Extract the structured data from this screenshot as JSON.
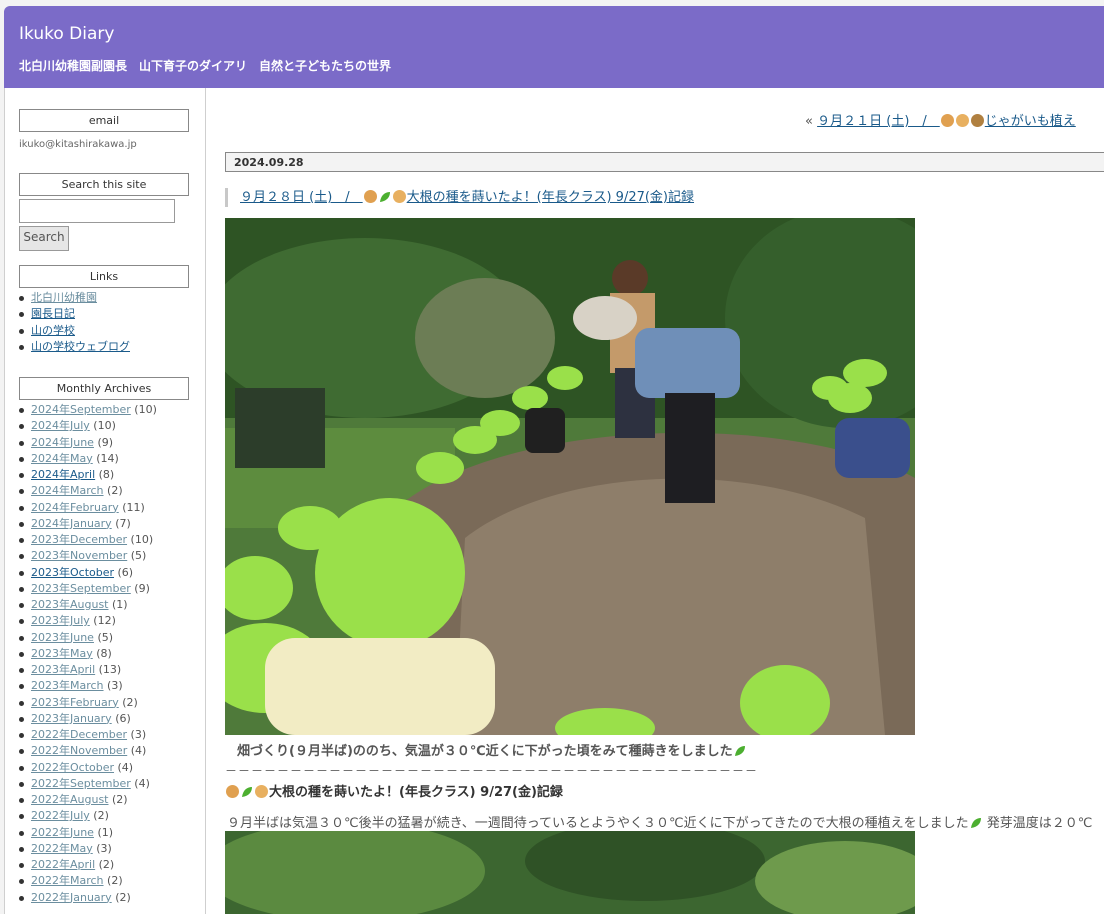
{
  "header": {
    "title": "Ikuko Diary",
    "subtitle": "北白川幼稚園副園長　山下育子のダイアリ　自然と子どもたちの世界"
  },
  "sidebar": {
    "email_title": "email",
    "email": "ikuko@kitashirakawa.jp",
    "search_title": "Search this site",
    "search_value": "",
    "search_button": "Search",
    "links_title": "Links",
    "links": [
      "北白川幼稚園",
      "園長日記",
      "山の学校",
      "山の学校ウェブログ"
    ],
    "archives_title": "Monthly Archives",
    "archives": [
      {
        "label": "2024年September",
        "count": "(10)"
      },
      {
        "label": "2024年July",
        "count": "(10)"
      },
      {
        "label": "2024年June",
        "count": "(9)"
      },
      {
        "label": "2024年May",
        "count": "(14)"
      },
      {
        "label": "2024年April",
        "count": "(8)"
      },
      {
        "label": "2024年March",
        "count": "(2)"
      },
      {
        "label": "2024年February",
        "count": "(11)"
      },
      {
        "label": "2024年January",
        "count": "(7)"
      },
      {
        "label": "2023年December",
        "count": "(10)"
      },
      {
        "label": "2023年November",
        "count": "(5)"
      },
      {
        "label": "2023年October",
        "count": "(6)"
      },
      {
        "label": "2023年September",
        "count": "(9)"
      },
      {
        "label": "2023年August",
        "count": "(1)"
      },
      {
        "label": "2023年July",
        "count": "(12)"
      },
      {
        "label": "2023年June",
        "count": "(5)"
      },
      {
        "label": "2023年May",
        "count": "(8)"
      },
      {
        "label": "2023年April",
        "count": "(13)"
      },
      {
        "label": "2023年March",
        "count": "(3)"
      },
      {
        "label": "2023年February",
        "count": "(2)"
      },
      {
        "label": "2023年January",
        "count": "(6)"
      },
      {
        "label": "2022年December",
        "count": "(3)"
      },
      {
        "label": "2022年November",
        "count": "(4)"
      },
      {
        "label": "2022年October",
        "count": "(4)"
      },
      {
        "label": "2022年September",
        "count": "(4)"
      },
      {
        "label": "2022年August",
        "count": "(2)"
      },
      {
        "label": "2022年July",
        "count": "(2)"
      },
      {
        "label": "2022年June",
        "count": "(1)"
      },
      {
        "label": "2022年May",
        "count": "(3)"
      },
      {
        "label": "2022年April",
        "count": "(2)"
      },
      {
        "label": "2022年March",
        "count": "(2)"
      },
      {
        "label": "2022年January",
        "count": "(2)"
      }
    ]
  },
  "main": {
    "nav_prefix": "«",
    "nav_prev": "９月２１日 (土)　/　",
    "nav_prev_tail": "じゃがいも植え",
    "date": "2024.09.28",
    "post_title_prefix": "９月２８日 (土)　/　",
    "post_title_tail": "大根の種を蒔いたよ！(年長クラス) 9/27(金)記録",
    "caption": "畑づくり(９月半ば)ののち、気温が３０℃近くに下がった頃をみて種蒔きをしました",
    "dashes": "－－－－－－－－－－－－－－－－－－－－－－－－－－－－－－－－－－－－－－－－－",
    "subhead": "大根の種を蒔いたよ！(年長クラス) 9/27(金)記録",
    "body": "９月半ばは気温３０℃後半の猛暑が続き、一週間待っているとようやく３０℃近くに下がってきたので大根の種植えをしました",
    "body_tail": "発芽温度は２０℃"
  }
}
